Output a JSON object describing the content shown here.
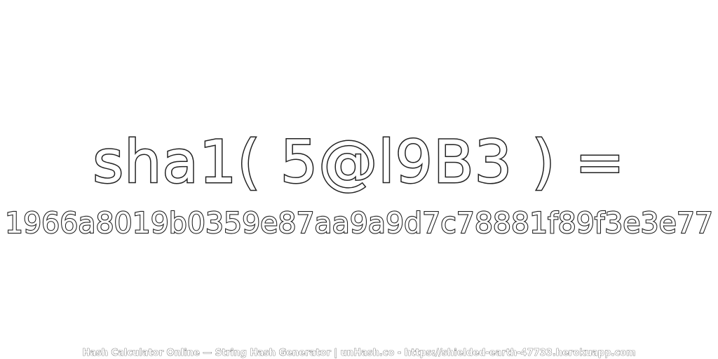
{
  "headline": "sha1( 5@l9B3 ) =",
  "hash_value": "1966a8019b0359e87aa9a9d7c78881f89f3e3e77",
  "footer_text": "Hash Calculator Online — String Hash Generator | unHash.co - https://shielded-earth-47733.herokuapp.com",
  "colors": {
    "outline": "#222222",
    "fill": "#ffffff",
    "background": "#ffffff"
  }
}
